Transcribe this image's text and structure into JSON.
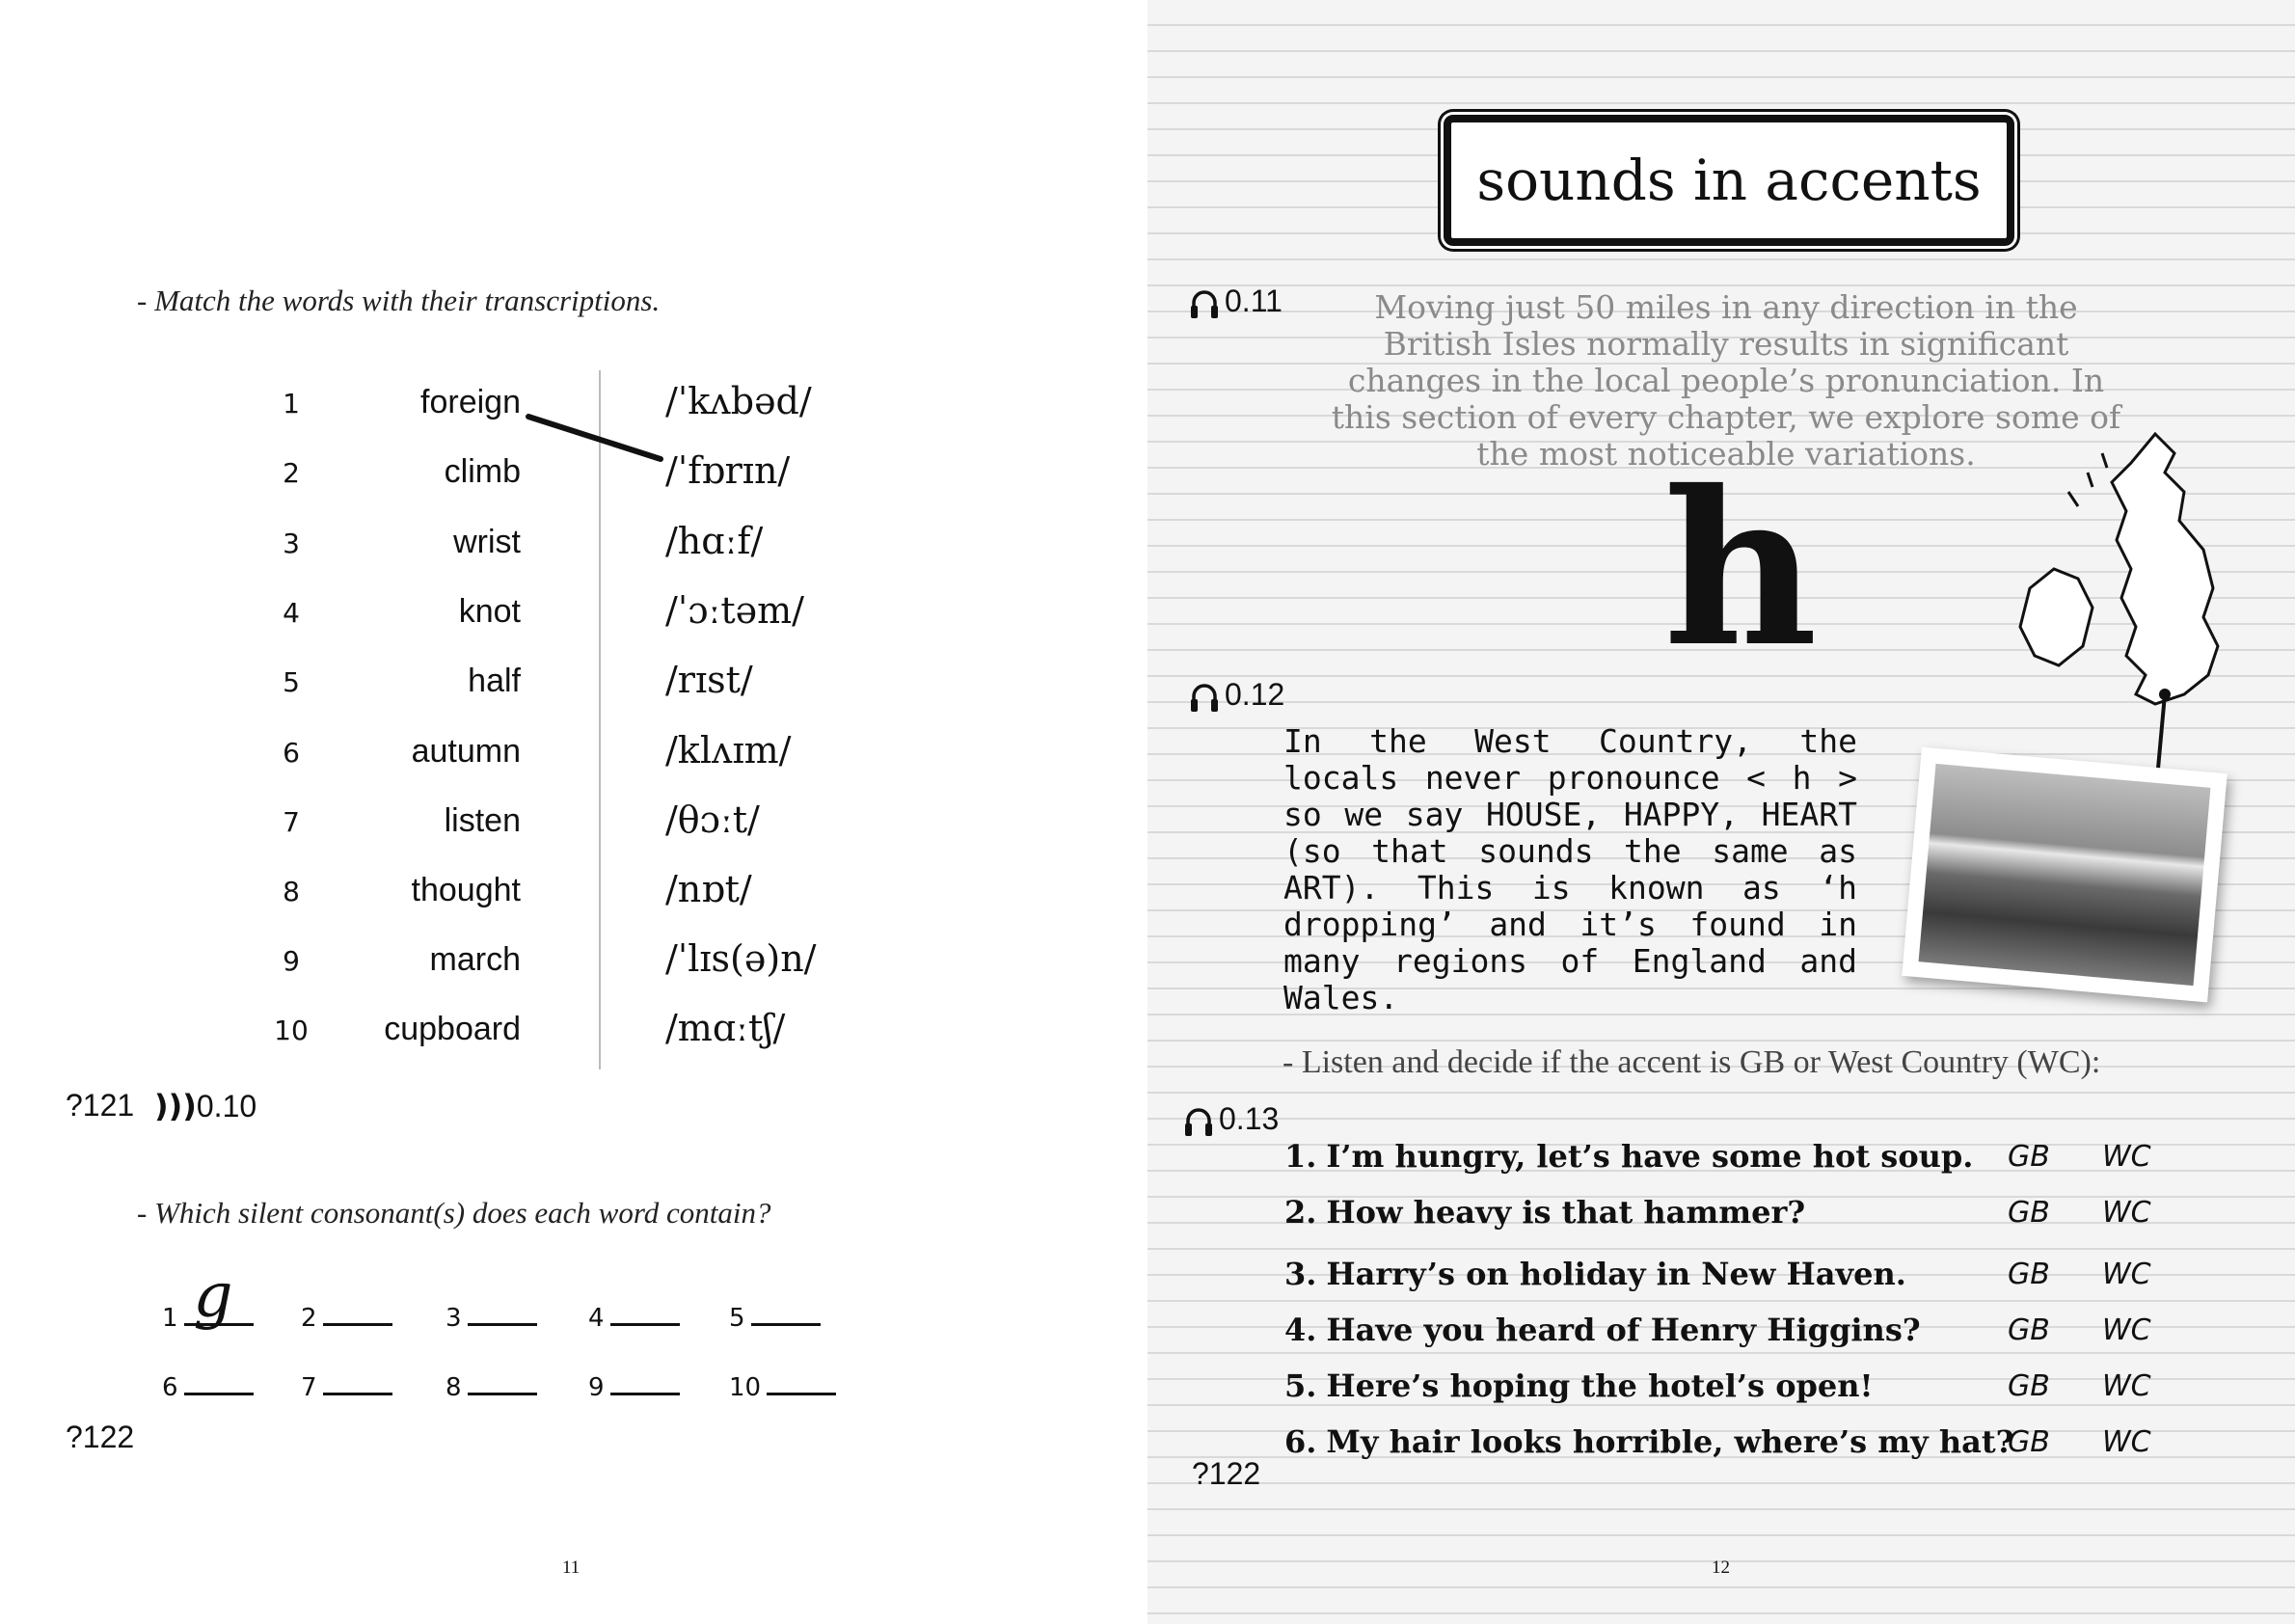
{
  "left": {
    "instruction1": "- Match the words with their transcriptions.",
    "pairs": [
      {
        "num": "1",
        "word": "foreign",
        "ipa": "/ˈkʌbəd/"
      },
      {
        "num": "2",
        "word": "climb",
        "ipa": "/ˈfɒrɪn/"
      },
      {
        "num": "3",
        "word": "wrist",
        "ipa": "/hɑːf/"
      },
      {
        "num": "4",
        "word": "knot",
        "ipa": "/ˈɔːtəm/"
      },
      {
        "num": "5",
        "word": "half",
        "ipa": "/rɪst/"
      },
      {
        "num": "6",
        "word": "autumn",
        "ipa": "/klʌɪm/"
      },
      {
        "num": "7",
        "word": "listen",
        "ipa": "/θɔːt/"
      },
      {
        "num": "8",
        "word": "thought",
        "ipa": "/nɒt/"
      },
      {
        "num": "9",
        "word": "march",
        "ipa": "/ˈlɪs(ə)n/"
      },
      {
        "num": "10",
        "word": "cupboard",
        "ipa": "/mɑːtʃ/"
      }
    ],
    "ref1": "?121",
    "audio1": "0.10",
    "instruction2": "- Which silent consonant(s) does each word contain?",
    "blanks_row1": [
      "1",
      "2",
      "3",
      "4",
      "5"
    ],
    "blanks_row2": [
      "6",
      "7",
      "8",
      "9",
      "10"
    ],
    "handwritten_answer": "g",
    "ref2": "?122",
    "page_number": "11"
  },
  "right": {
    "title": "sounds in accents",
    "audio1": "0.11",
    "intro_lines": [
      "Moving just 50 miles in any direction in the",
      "British Isles normally results in significant",
      "changes in the local people’s pronunciation. In",
      "this section of every chapter, we explore some of",
      "the most noticeable variations."
    ],
    "big_letter": "h",
    "audio2": "0.12",
    "body": "In the West Country, the locals never pronounce < h > so we say HOUSE, HAPPY, HEART (so that sounds the same as ART). This is known as ‘h dropping’ and it’s found in many regions of England and Wales.",
    "listen_instruction": "- Listen and decide if the accent is GB or West Country (WC):",
    "audio3": "0.13",
    "sentences": [
      {
        "num": "1.",
        "text": "I’m hungry, let’s have some hot soup.",
        "opt1": "GB",
        "opt2": "WC"
      },
      {
        "num": "2.",
        "text": "How heavy is that hammer?",
        "opt1": "GB",
        "opt2": "WC"
      },
      {
        "num": "3.",
        "text": "Harry’s on holiday in New Haven.",
        "opt1": "GB",
        "opt2": "WC"
      },
      {
        "num": "4.",
        "text": "Have you heard of Henry Higgins?",
        "opt1": "GB",
        "opt2": "WC"
      },
      {
        "num": "5.",
        "text": "Here’s hoping the hotel’s open!",
        "opt1": "GB",
        "opt2": "WC"
      },
      {
        "num": "6.",
        "text": "My hair looks horrible, where’s my hat?",
        "opt1": "GB",
        "opt2": "WC"
      }
    ],
    "ref": "?122",
    "page_number": "12"
  },
  "icons": [
    "headphones-icon",
    "sound-wave-icon",
    "question-mark-icon",
    "uk-map-icon",
    "photo"
  ]
}
